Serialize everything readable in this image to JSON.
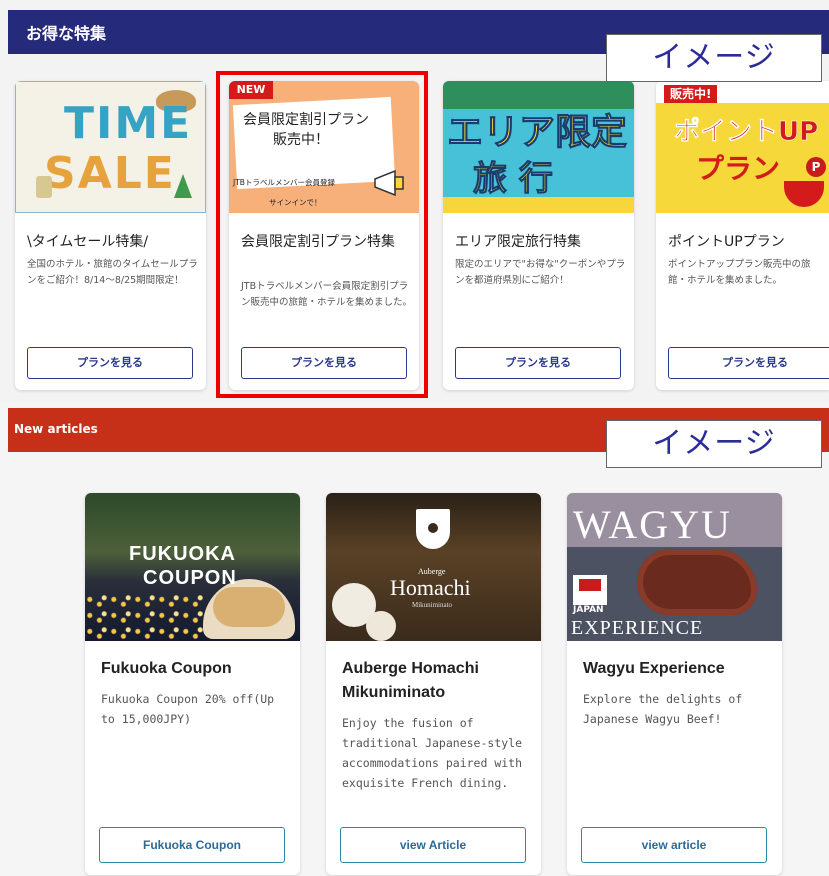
{
  "section1": {
    "title": "お得な特集",
    "image_tag": "イメージ",
    "cards": [
      {
        "title": "\\タイムセール特集/",
        "description": "全国のホテル・旅館のタイムセールプランをご紹介！8/14〜8/25期間限定！",
        "button": "プランを見る",
        "thumb_text": [
          "TIME",
          "SALE"
        ]
      },
      {
        "title": "会員限定割引プラン特集",
        "description": "JTBトラベルメンバー会員限定割引プラン販売中の旅館・ホテルを集めました。",
        "button": "プランを見る",
        "badge": "NEW",
        "thumb_text": [
          "会員限定割引プラン",
          "販売中！",
          "JTBトラベルメンバー会員登録",
          "サインインで！"
        ]
      },
      {
        "title": "エリア限定旅行特集",
        "description": "限定のエリアで\"お得な\"クーポンやプランを都道府県別にご紹介！",
        "button": "プランを見る",
        "thumb_text": [
          "エリア限定",
          "旅 行"
        ]
      },
      {
        "title": "ポイントUPプラン",
        "description": "ポイントアッププラン販売中の旅館・ホテルを集めました。",
        "button": "プランを見る",
        "badge": "販売中!",
        "thumb_text": [
          "ポイントUP",
          "プラン"
        ]
      }
    ]
  },
  "section2": {
    "title": "New articles",
    "image_tag": "イメージ",
    "articles": [
      {
        "title": "Fukuoka Coupon",
        "description": "Fukuoka Coupon 20% off(Up to 15,000JPY)",
        "button": "Fukuoka Coupon",
        "thumb_text": [
          "FUKUOKA",
          "COUPON"
        ]
      },
      {
        "title": "Auberge Homachi Mikuniminato",
        "description": "Enjoy the fusion of traditional Japanese-style accommodations paired with exquisite French dining.",
        "button": "view Article",
        "thumb_text": [
          "Auberge",
          "Homachi",
          "Mikuniminato"
        ]
      },
      {
        "title": "Wagyu Experience",
        "description": "Explore the delights of Japanese Wagyu Beef!",
        "button": "view article",
        "thumb_text": [
          "WAGYU",
          "JAPAN",
          "EXPERIENCE"
        ]
      }
    ]
  },
  "colors": {
    "section1_header": "#252a7a",
    "section2_header": "#c63018",
    "highlight_box": "#ee0000",
    "button_border": "#2c3a8c"
  }
}
